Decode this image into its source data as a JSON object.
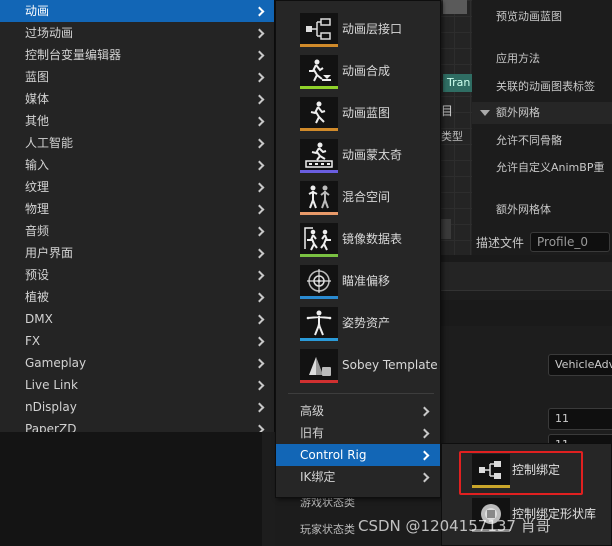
{
  "menu1": {
    "items": [
      {
        "label": "动画"
      },
      {
        "label": "过场动画"
      },
      {
        "label": "控制台变量编辑器"
      },
      {
        "label": "蓝图"
      },
      {
        "label": "媒体"
      },
      {
        "label": "其他"
      },
      {
        "label": "人工智能"
      },
      {
        "label": "输入"
      },
      {
        "label": "纹理"
      },
      {
        "label": "物理"
      },
      {
        "label": "音频"
      },
      {
        "label": "用户界面"
      },
      {
        "label": "预设"
      },
      {
        "label": "植被"
      },
      {
        "label": "DMX"
      },
      {
        "label": "FX"
      },
      {
        "label": "Gameplay"
      },
      {
        "label": "Live Link"
      },
      {
        "label": "nDisplay"
      },
      {
        "label": "PaperZD"
      }
    ]
  },
  "menu2": {
    "icon_items": [
      {
        "label": "动画层接口",
        "icon": "animation-layer-interface-icon",
        "accent": "#d08a2a"
      },
      {
        "label": "动画合成",
        "icon": "animation-composite-icon",
        "accent": "#8fd12a"
      },
      {
        "label": "动画蓝图",
        "icon": "animation-blueprint-icon",
        "accent": "#d08a2a"
      },
      {
        "label": "动画蒙太奇",
        "icon": "animation-montage-icon",
        "accent": "#6a5ee0"
      },
      {
        "label": "混合空间",
        "icon": "blend-space-icon",
        "accent": "#e89a6a"
      },
      {
        "label": "镜像数据表",
        "icon": "mirror-data-table-icon",
        "accent": "#7ac142"
      },
      {
        "label": "瞄准偏移",
        "icon": "aim-offset-icon",
        "accent": "#2a8ad0"
      },
      {
        "label": "姿势资产",
        "icon": "pose-asset-icon",
        "accent": "#2a9ad8"
      },
      {
        "label": "Sobey Template",
        "icon": "sobey-template-icon",
        "accent": "#d03030"
      }
    ],
    "sub_items": [
      {
        "label": "高级"
      },
      {
        "label": "旧有"
      },
      {
        "label": "Control Rig"
      },
      {
        "label": "IK绑定"
      }
    ]
  },
  "menu3": {
    "items": [
      {
        "label": "控制绑定",
        "icon": "control-rig-icon",
        "accent": "#c9a52a"
      },
      {
        "label": "控制绑定形状库",
        "icon": "control-rig-shape-library-icon",
        "accent": "#888888"
      }
    ]
  },
  "background": {
    "graph_node_label": "Tran",
    "graph_text_1": "目",
    "graph_text_2": "类型",
    "details": {
      "preview_label": "预览动画蓝图",
      "apply_method": "应用方法",
      "linked_tag": "关联的动画图表标签",
      "extra_mesh_section": "额外网格",
      "allow_diff_skeleton": "允许不同骨骼",
      "allow_custom_bp": "允许自定义AnimBP重",
      "extra_mesh_body": "额外网格体",
      "describe_file": "描述文件",
      "profile_value": "Profile_0"
    },
    "fields": {
      "vehicle": "VehicleAdv",
      "num1": "11",
      "num2": "11"
    },
    "lower_list": [
      "游戏状态类",
      "玩家状态类"
    ]
  },
  "watermark": "CSDN @1204157137 肖哥",
  "colors": {
    "highlight": "#1266b6",
    "annotation": "#e02020"
  }
}
